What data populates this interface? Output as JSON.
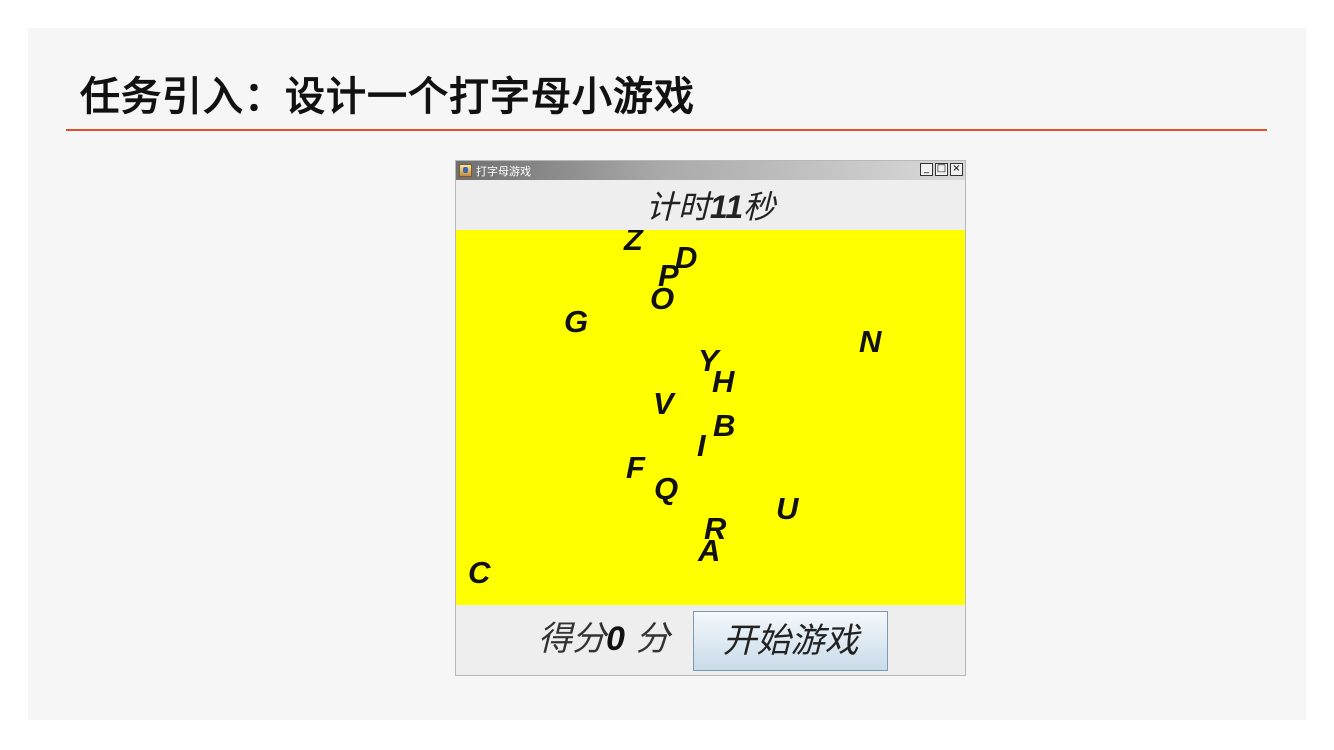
{
  "slide": {
    "title": "任务引入：设计一个打字母小游戏"
  },
  "window": {
    "title": "打字母游戏",
    "controls": {
      "minimize": "_",
      "maximize": "□",
      "close": "×"
    }
  },
  "timer": {
    "prefix": "计时",
    "value": "11",
    "suffix": "秒"
  },
  "letters": [
    "Z",
    "D",
    "P",
    "O",
    "G",
    "N",
    "Y",
    "H",
    "V",
    "B",
    "I",
    "F",
    "Q",
    "U",
    "R",
    "A",
    "C"
  ],
  "score": {
    "prefix": "得分",
    "value": "0",
    "suffix": " 分"
  },
  "start_button": {
    "label": "开始游戏"
  },
  "colors": {
    "accent_rule": "#e2502a",
    "field_background": "#ffff00"
  }
}
